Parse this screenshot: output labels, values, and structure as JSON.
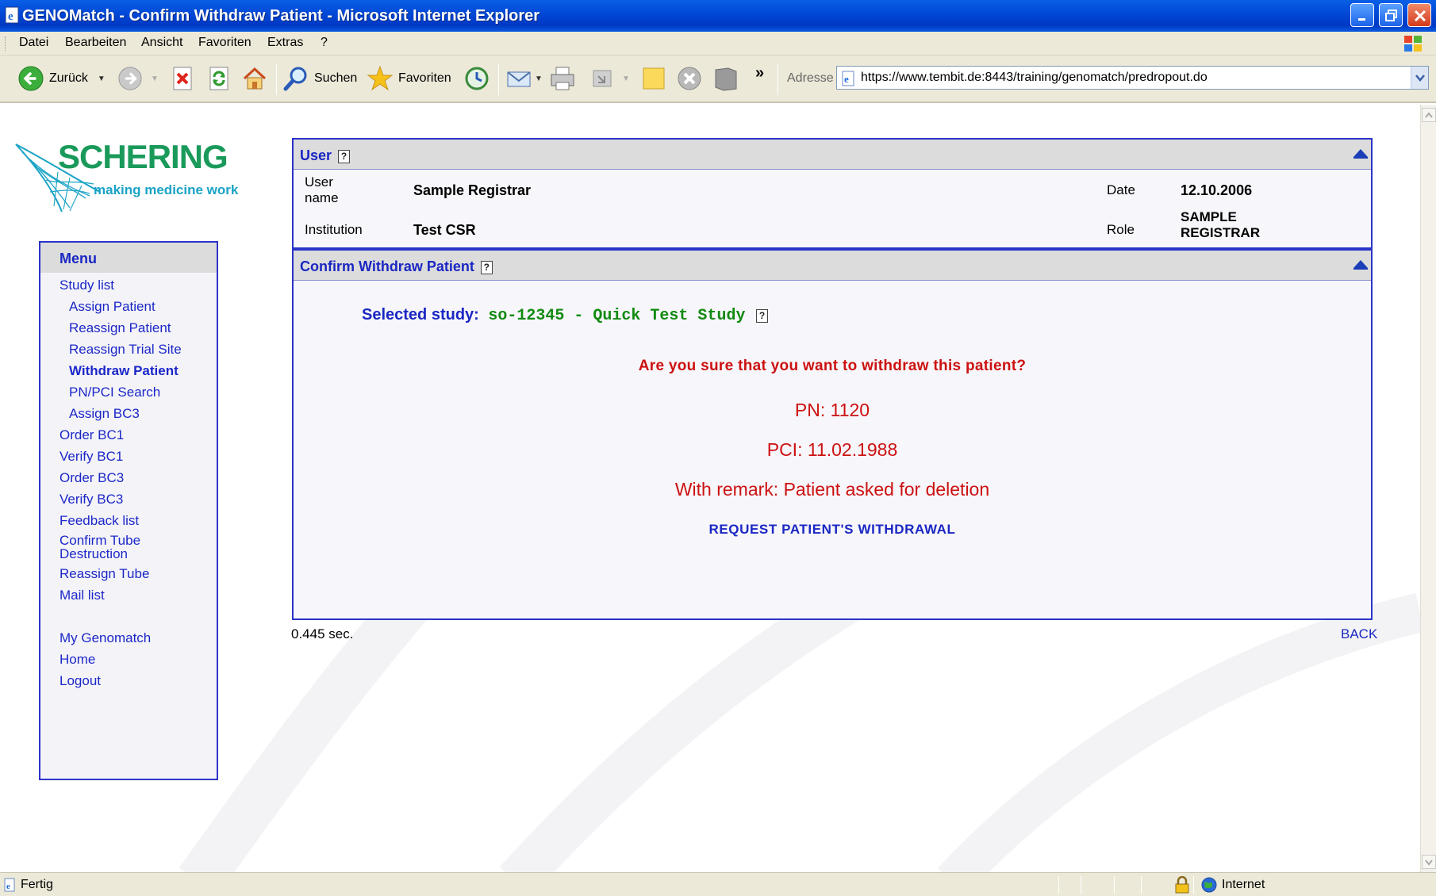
{
  "window": {
    "title": "GENOMatch - Confirm Withdraw Patient - Microsoft Internet Explorer"
  },
  "menubar": {
    "items": [
      "Datei",
      "Bearbeiten",
      "Ansicht",
      "Favoriten",
      "Extras",
      "?"
    ]
  },
  "toolbar": {
    "back_label": "Zurück",
    "search_label": "Suchen",
    "favorites_label": "Favoriten",
    "address_label": "Adresse",
    "address_url": "https://www.tembit.de:8443/training/genomatch/predropout.do"
  },
  "logo": {
    "brand": "SCHERING",
    "tagline": "making medicine work"
  },
  "menu": {
    "title": "Menu",
    "items": [
      {
        "label": "Study list"
      },
      {
        "label": "Assign Patient"
      },
      {
        "label": "Reassign Patient"
      },
      {
        "label": "Reassign Trial Site"
      },
      {
        "label": "Withdraw Patient"
      },
      {
        "label": "PN/PCI Search"
      },
      {
        "label": "Assign BC3"
      },
      {
        "label": "Order BC1"
      },
      {
        "label": "Verify BC1"
      },
      {
        "label": "Order BC3"
      },
      {
        "label": "Verify BC3"
      },
      {
        "label": "Feedback list"
      },
      {
        "label": "Confirm Tube"
      },
      {
        "label": "Destruction"
      },
      {
        "label": "Reassign Tube"
      },
      {
        "label": "Mail list"
      },
      {
        "label": "My Genomatch"
      },
      {
        "label": "Home"
      },
      {
        "label": "Logout"
      }
    ]
  },
  "user_panel": {
    "title": "User",
    "help": "?",
    "user_name_label_1": "User",
    "user_name_label_2": "name",
    "user_name": "Sample Registrar",
    "institution_label": "Institution",
    "institution": "Test CSR",
    "date_label": "Date",
    "date": "12.10.2006",
    "role_label": "Role",
    "role_1": "SAMPLE",
    "role_2": "REGISTRAR"
  },
  "confirm_panel": {
    "title": "Confirm Withdraw Patient",
    "help": "?",
    "selected_study_label": "Selected study:",
    "selected_study_value": "so-12345 - Quick Test Study",
    "question": "Are you sure that you want to withdraw this patient?",
    "pn": "PN: 1120",
    "pci": "PCI: 11.02.1988",
    "remark": "With remark: Patient asked for deletion",
    "request_link": "REQUEST PATIENT'S WITHDRAWAL"
  },
  "footer": {
    "timing": "0.445 sec.",
    "back": "BACK"
  },
  "statusbar": {
    "status": "Fertig",
    "zone": "Internet"
  },
  "colors": {
    "link_blue": "#1a27c3",
    "alert_red": "#cc1111",
    "study_green": "#118a11",
    "brand_green": "#1a9a5a"
  }
}
